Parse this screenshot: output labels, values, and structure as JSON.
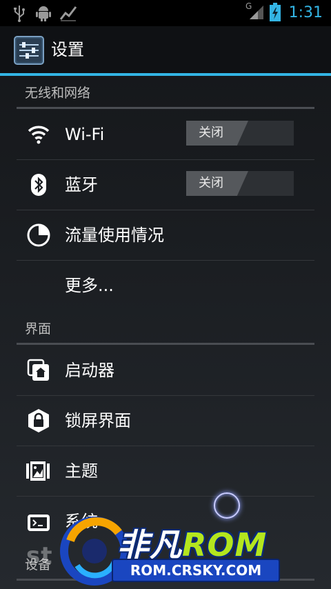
{
  "status_bar": {
    "time": "1:31",
    "network_type": "G",
    "icons": [
      "usb-icon",
      "android-debug-icon",
      "activity-icon",
      "signal-icon",
      "battery-charging-icon"
    ]
  },
  "action_bar": {
    "title": "设置",
    "icon": "settings-sliders-icon"
  },
  "sections": [
    {
      "header": "无线和网络",
      "items": [
        {
          "label": "Wi-Fi",
          "icon": "wifi-icon",
          "toggle": "关闭"
        },
        {
          "label": "蓝牙",
          "icon": "bluetooth-icon",
          "toggle": "关闭"
        },
        {
          "label": "流量使用情况",
          "icon": "data-usage-icon"
        },
        {
          "label": "更多...",
          "icon": ""
        }
      ]
    },
    {
      "header": "界面",
      "items": [
        {
          "label": "启动器",
          "icon": "launcher-icon"
        },
        {
          "label": "锁屏界面",
          "icon": "lock-icon"
        },
        {
          "label": "主题",
          "icon": "theme-icon"
        },
        {
          "label": "系统",
          "icon": "system-icon"
        }
      ]
    },
    {
      "header": "设备",
      "items": []
    }
  ],
  "watermark": {
    "brand_prefix": "非凡",
    "brand_suffix": "ROM",
    "url": "ROM.CRSKY.COM",
    "faint_text": "st"
  },
  "colors": {
    "accent": "#33b5e5",
    "background": "#1b1e22",
    "text": "#ffffff",
    "section_text": "#bdbdbd"
  }
}
